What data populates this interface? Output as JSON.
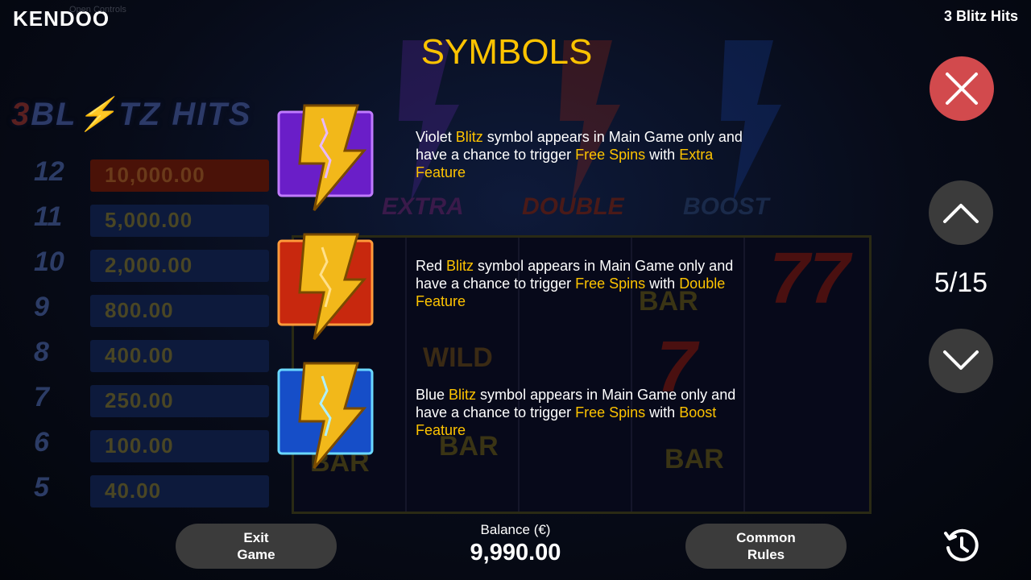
{
  "header": {
    "logo": "KENDOO",
    "open_controls": "Open Controls",
    "game_name": "3 Blitz Hits"
  },
  "title": "SYMBOLS",
  "symbols": [
    {
      "icon": "violet-blitz-symbol-icon",
      "color": "#7a2ad8",
      "parts": [
        "Violet ",
        "Blitz",
        " symbol appears in Main Game only and have a chance to trigger ",
        "Free Spins",
        " with ",
        "Extra Feature"
      ]
    },
    {
      "icon": "red-blitz-symbol-icon",
      "color": "#d22a10",
      "parts": [
        "Red ",
        "Blitz",
        " symbol appears in Main Game only and have a chance to trigger ",
        "Free Spins",
        " with ",
        "Double Feature"
      ]
    },
    {
      "icon": "blue-blitz-symbol-icon",
      "color": "#1a5ad8",
      "parts": [
        "Blue ",
        "Blitz",
        " symbol appears in Main Game only and have a chance to trigger ",
        "Free Spins",
        " with ",
        "Boost Feature"
      ]
    }
  ],
  "nav": {
    "page_indicator": "5/15",
    "close_icon": "close-icon",
    "up_icon": "chevron-up-icon",
    "down_icon": "chevron-down-icon"
  },
  "footer": {
    "exit_line1": "Exit",
    "exit_line2": "Game",
    "balance_label": "Balance (€)",
    "balance_value": "9,990.00",
    "rules_line1": "Common",
    "rules_line2": "Rules",
    "history_icon": "history-icon"
  },
  "colors": {
    "accent": "#fdc300",
    "close": "#d24a4d",
    "button": "#3b3b3b"
  }
}
